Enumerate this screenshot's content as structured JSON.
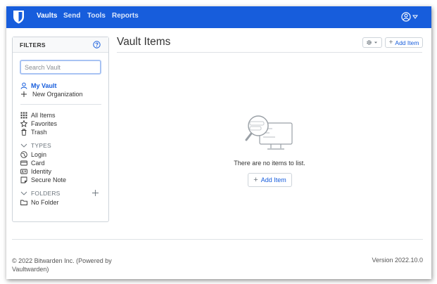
{
  "nav": {
    "links": [
      "Vaults",
      "Send",
      "Tools",
      "Reports"
    ]
  },
  "filters": {
    "title": "FILTERS",
    "search_placeholder": "Search Vault",
    "my_vault": "My Vault",
    "new_org": "New Organization",
    "all_items": "All Items",
    "favorites": "Favorites",
    "trash": "Trash",
    "types_heading": "TYPES",
    "types": [
      "Login",
      "Card",
      "Identity",
      "Secure Note"
    ],
    "folders_heading": "FOLDERS",
    "no_folder": "No Folder"
  },
  "main": {
    "title": "Vault Items",
    "add_item": "Add Item",
    "empty_text": "There are no items to list."
  },
  "footer": {
    "copyright": "© 2022 Bitwarden Inc. (Powered by Vaultwarden)",
    "version": "Version 2022.10.0"
  },
  "colors": {
    "brand": "#175ddc"
  },
  "icons": [
    "bitwarden-shield-icon",
    "user-circle-icon",
    "question-circle-icon",
    "user-icon",
    "plus-icon",
    "grid-icon",
    "star-icon",
    "trash-icon",
    "chevron-down-icon",
    "globe-icon",
    "credit-card-icon",
    "id-card-icon",
    "sticky-note-icon",
    "folder-icon",
    "gear-icon",
    "no-items-illustration"
  ]
}
